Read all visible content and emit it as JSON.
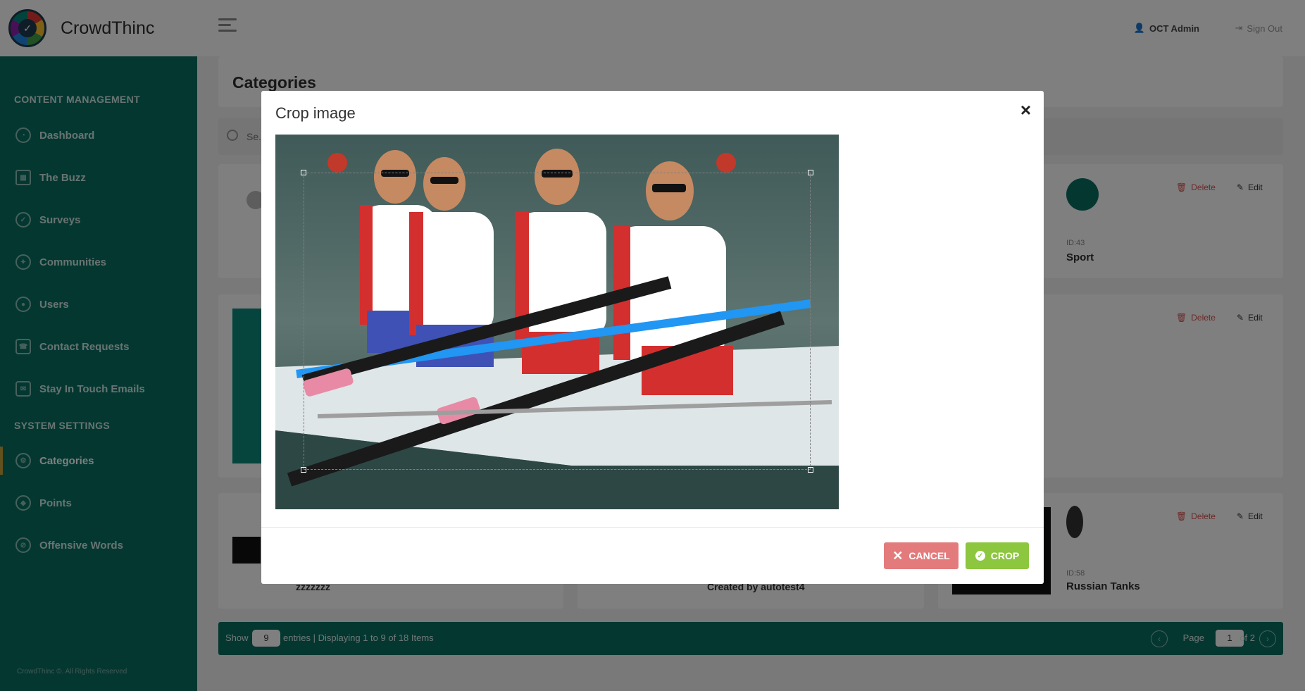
{
  "app": {
    "name": "CrowdThinc"
  },
  "sidebar": {
    "sections": [
      {
        "title": "CONTENT MANAGEMENT"
      },
      {
        "title": "SYSTEM SETTINGS"
      }
    ],
    "items": [
      {
        "label": "Dashboard",
        "icon": "dashboard-icon"
      },
      {
        "label": "The Buzz",
        "icon": "buzz-icon"
      },
      {
        "label": "Surveys",
        "icon": "surveys-icon"
      },
      {
        "label": "Communities",
        "icon": "communities-icon"
      },
      {
        "label": "Users",
        "icon": "users-icon"
      },
      {
        "label": "Contact Requests",
        "icon": "contact-icon"
      },
      {
        "label": "Stay In Touch Emails",
        "icon": "email-icon"
      },
      {
        "label": "Categories",
        "icon": "categories-icon",
        "active": true
      },
      {
        "label": "Points",
        "icon": "points-icon"
      },
      {
        "label": "Offensive Words",
        "icon": "offensive-icon"
      }
    ],
    "footer": "CrowdThinc ©. All Rights Reserved"
  },
  "topbar": {
    "user": "OCT Admin",
    "signout": "Sign Out"
  },
  "page": {
    "title": "Categories",
    "search_placeholder": "Se..."
  },
  "cards": [
    {
      "id_label": "ID:43",
      "name": "Sport",
      "delete": "Delete",
      "edit": "Edit"
    },
    {
      "delete": "Delete",
      "edit": "Edit"
    },
    {
      "id_label": "ID:58",
      "name": "Russian Tanks",
      "delete": "Delete",
      "edit": "Edit"
    },
    {
      "caption": "zzzzzzz"
    },
    {
      "caption": "Created by autotest4"
    }
  ],
  "pagination": {
    "show": "Show",
    "page_size": "9",
    "entries": "entries | Displaying 1 to 9 of 18 Items",
    "page_label": "Page",
    "page": "1",
    "total": "of 2"
  },
  "modal": {
    "title": "Crop image",
    "close": "×",
    "cancel": "CANCEL",
    "crop": "CROP"
  },
  "colors": {
    "primary": "#0b6e63",
    "cancel": "#e37b7c",
    "crop": "#8dc63f",
    "danger": "#d9534f"
  }
}
